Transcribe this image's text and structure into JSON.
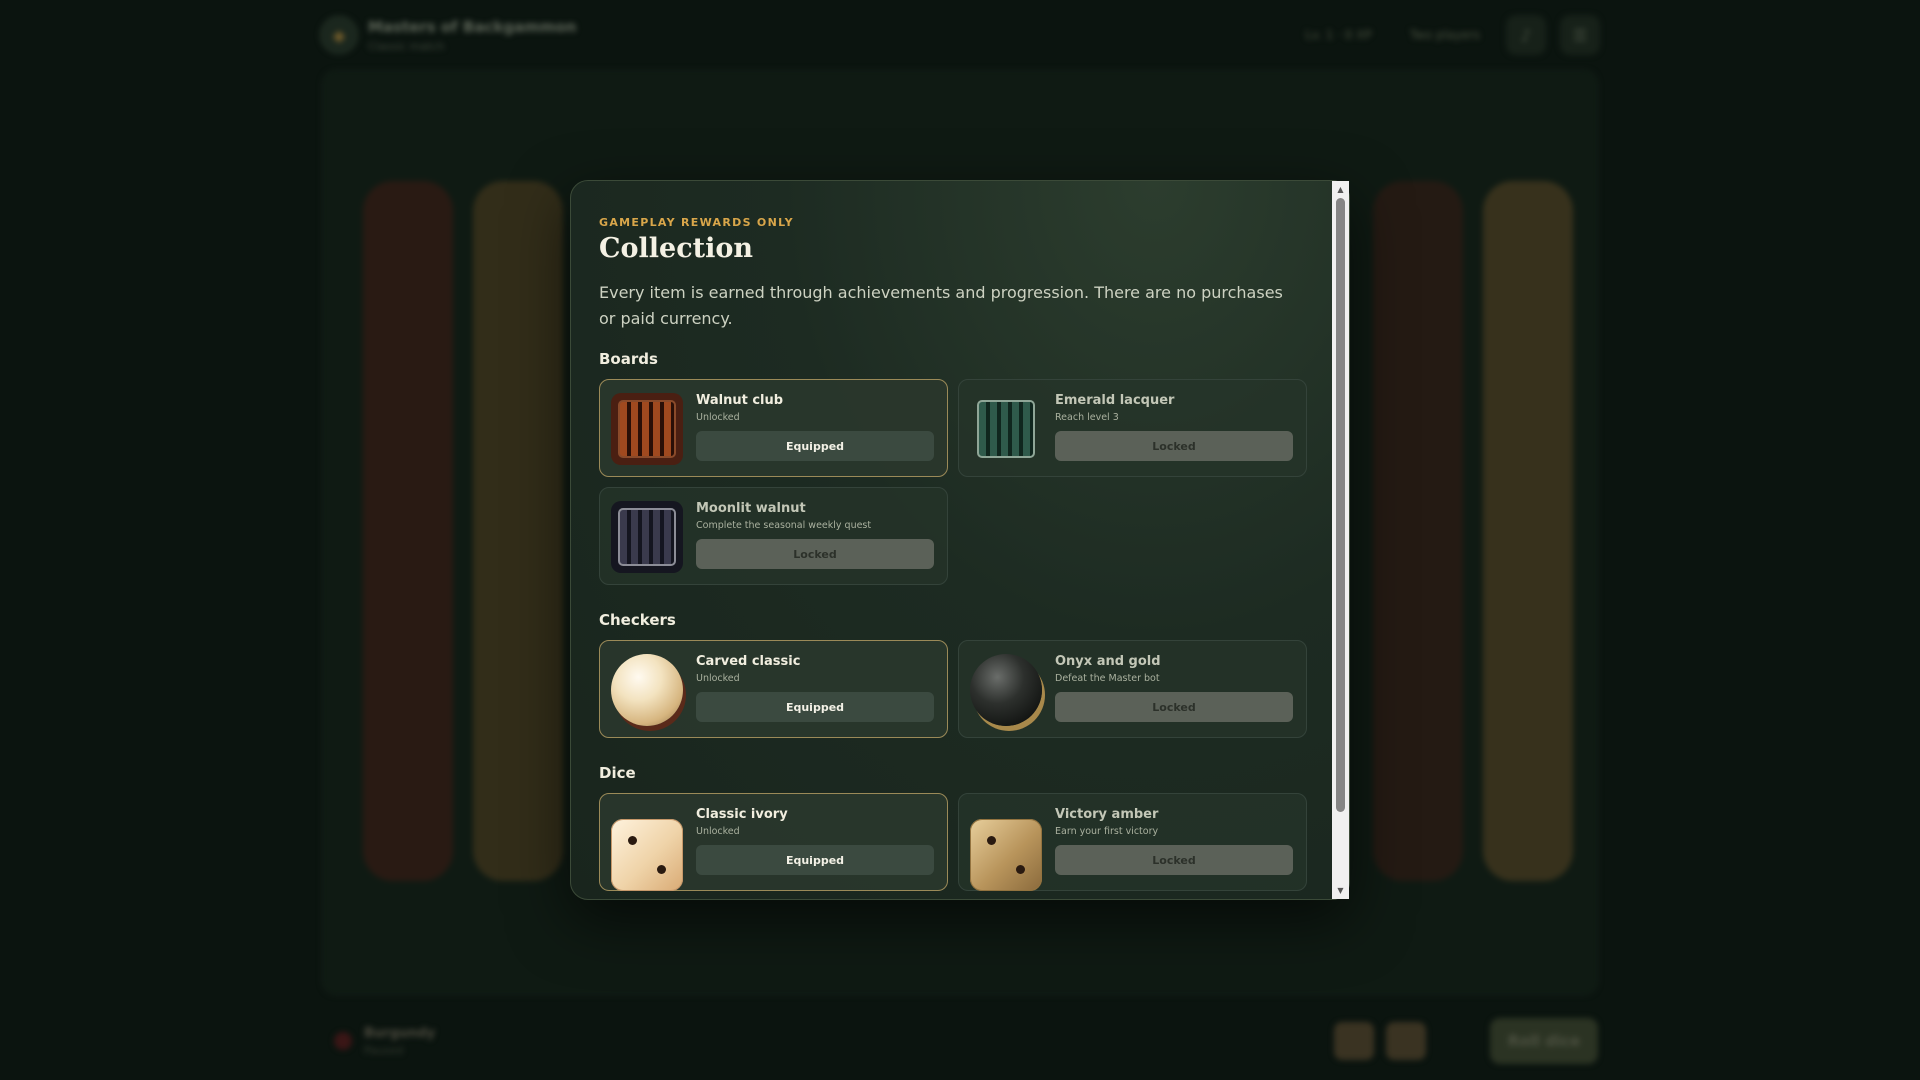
{
  "header": {
    "title": "Masters of Backgammon",
    "subtitle": "Classic match",
    "level": "Lv. 1 · 0 XP",
    "mode": "Two players",
    "music_icon": "music-note-icon",
    "menu_icon": "hamburger-menu-icon"
  },
  "footer": {
    "player_name": "Burgundy",
    "player_status": "Paused",
    "roll_label": "Roll dice"
  },
  "modal": {
    "eyebrow": "GAMEPLAY REWARDS ONLY",
    "title": "Collection",
    "description": "Every item is earned through achievements and progression. There are no purchases or paid currency.",
    "sections": {
      "boards": {
        "title": "Boards",
        "items": [
          {
            "name": "Walnut club",
            "status": "Unlocked",
            "button": "Equipped"
          },
          {
            "name": "Emerald lacquer",
            "status": "Reach level 3",
            "button": "Locked"
          },
          {
            "name": "Moonlit walnut",
            "status": "Complete the seasonal weekly quest",
            "button": "Locked"
          }
        ]
      },
      "checkers": {
        "title": "Checkers",
        "items": [
          {
            "name": "Carved classic",
            "status": "Unlocked",
            "button": "Equipped"
          },
          {
            "name": "Onyx and gold",
            "status": "Defeat the Master bot",
            "button": "Locked"
          }
        ]
      },
      "dice": {
        "title": "Dice",
        "items": [
          {
            "name": "Classic ivory",
            "status": "Unlocked",
            "button": "Equipped"
          },
          {
            "name": "Victory amber",
            "status": "Earn your first victory",
            "button": "Locked"
          }
        ]
      }
    }
  },
  "colors": {
    "accent_gold": "#d9a64a",
    "equipped_border": "#9b8a58",
    "background": "#0b140f"
  }
}
